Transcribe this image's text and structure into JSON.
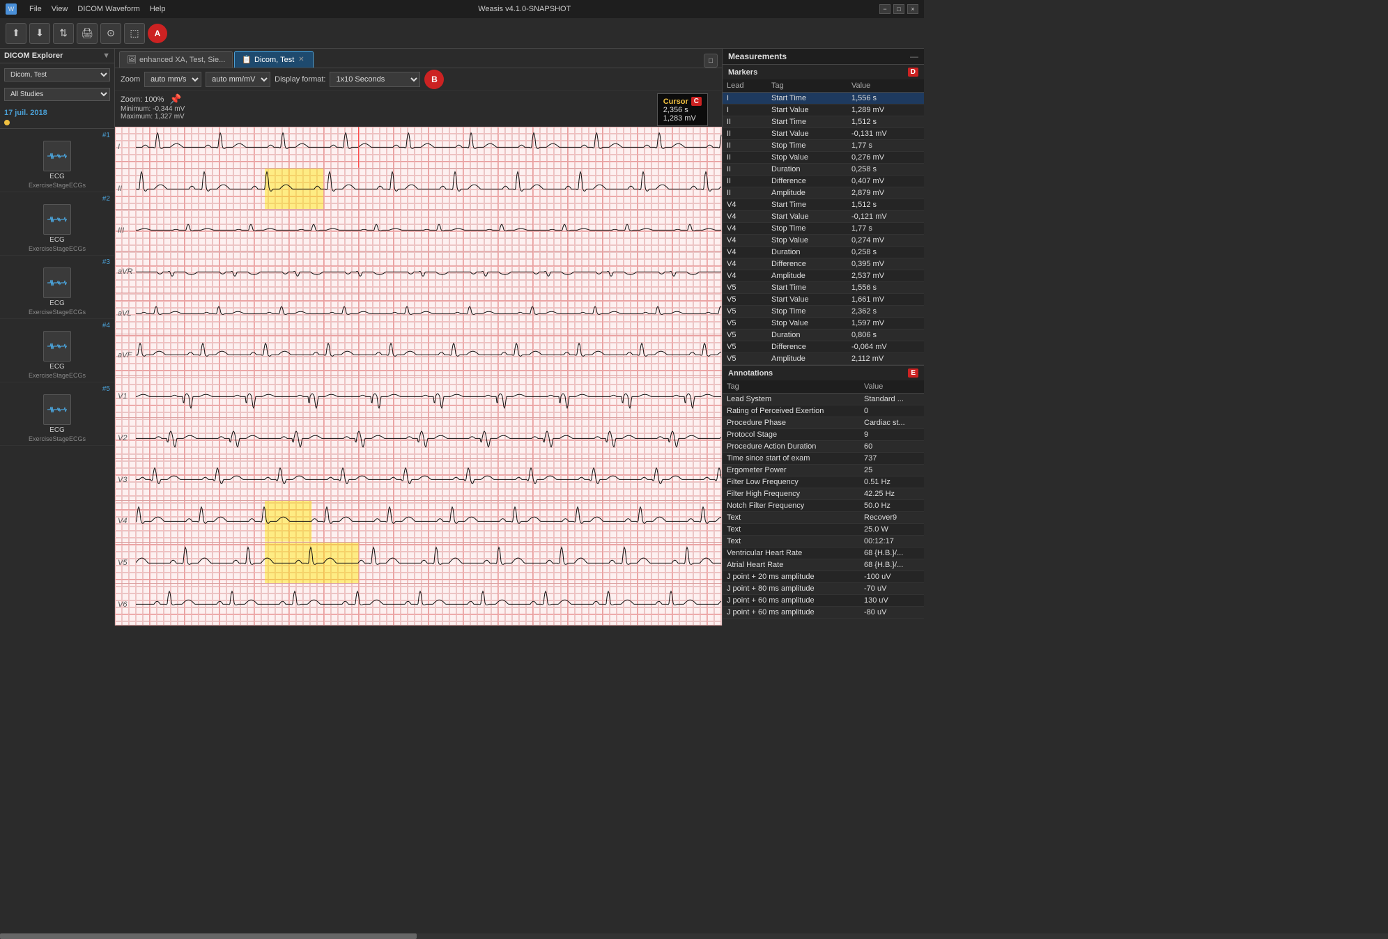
{
  "app": {
    "title": "Weasis v4.1.0-SNAPSHOT",
    "icon": "W"
  },
  "titleBar": {
    "menus": [
      "File",
      "View",
      "DICOM Waveform",
      "Help"
    ],
    "controls": [
      "−",
      "□",
      "×"
    ]
  },
  "toolbar": {
    "buttons": [
      "import-icon",
      "export-icon",
      "open-icon",
      "print-icon",
      "circ-icon",
      "rect-icon"
    ],
    "labelA": "A"
  },
  "tabs": [
    {
      "id": "tab1",
      "label": "enhanced XA, Test, Sie...",
      "active": false,
      "closable": false,
      "icon": "🖼"
    },
    {
      "id": "tab2",
      "label": "Dicom, Test",
      "active": true,
      "closable": true,
      "icon": "📋"
    }
  ],
  "controls": {
    "zoomLabel": "Zoom",
    "zoomOptions": [
      "auto mm/s"
    ],
    "zoomOptions2": [
      "auto mm/mV"
    ],
    "displayFormatLabel": "Display format:",
    "displayFormatOptions": [
      "1x10 Seconds"
    ],
    "labelB": "B"
  },
  "zoomInfo": {
    "zoom": "Zoom: 100%",
    "cursor_label": "Cursor",
    "labelC": "C",
    "minimum": "Minimum: -0,344 mV",
    "maximum": "Maximum: 1,327 mV",
    "cursorTime": "2,356 s",
    "cursorValue": "1,283 mV"
  },
  "sidebar": {
    "title": "DICOM Explorer",
    "patientSelect": "Dicom, Test",
    "studySelect": "All Studies",
    "dateLabel": "17 juil. 2018",
    "studies": [
      {
        "num": "#1",
        "type": "ECG",
        "label": "ECG",
        "sublabel": "ExerciseStageECGs",
        "hasDot": true
      },
      {
        "num": "#2",
        "type": "ECG",
        "label": "ECG",
        "sublabel": "ExerciseStageECGs",
        "hasDot": false
      },
      {
        "num": "#3",
        "type": "ECG",
        "label": "ECG",
        "sublabel": "ExerciseStageECGs",
        "hasDot": false
      },
      {
        "num": "#4",
        "type": "ECG",
        "label": "ECG",
        "sublabel": "ExerciseStageECGs",
        "hasDot": false
      },
      {
        "num": "#5",
        "type": "ECG",
        "label": "ECG",
        "sublabel": "ExerciseStageECGs",
        "hasDot": false
      }
    ]
  },
  "leads": [
    {
      "id": "I",
      "label": "I"
    },
    {
      "id": "II",
      "label": "II"
    },
    {
      "id": "III",
      "label": "III"
    },
    {
      "id": "aVR",
      "label": "aVR"
    },
    {
      "id": "aVL",
      "label": "aVL"
    },
    {
      "id": "aVF",
      "label": "aVF"
    },
    {
      "id": "V1",
      "label": "V1"
    },
    {
      "id": "V2",
      "label": "V2"
    },
    {
      "id": "V3",
      "label": "V3"
    },
    {
      "id": "V4",
      "label": "V4"
    },
    {
      "id": "V5",
      "label": "V5"
    },
    {
      "id": "V6",
      "label": "V6"
    }
  ],
  "measurements": {
    "title": "Measurements",
    "markersLabel": "Markers",
    "labelD": "D",
    "markersColumns": [
      "Lead",
      "Tag",
      "Value"
    ],
    "markers": [
      {
        "lead": "I",
        "tag": "Start Time",
        "value": "1,556 s"
      },
      {
        "lead": "I",
        "tag": "Start Value",
        "value": "1,289 mV"
      },
      {
        "lead": "II",
        "tag": "Start Time",
        "value": "1,512 s"
      },
      {
        "lead": "II",
        "tag": "Start Value",
        "value": "-0,131 mV"
      },
      {
        "lead": "II",
        "tag": "Stop Time",
        "value": "1,77 s"
      },
      {
        "lead": "II",
        "tag": "Stop Value",
        "value": "0,276 mV"
      },
      {
        "lead": "II",
        "tag": "Duration",
        "value": "0,258 s"
      },
      {
        "lead": "II",
        "tag": "Difference",
        "value": "0,407 mV"
      },
      {
        "lead": "II",
        "tag": "Amplitude",
        "value": "2,879 mV"
      },
      {
        "lead": "V4",
        "tag": "Start Time",
        "value": "1,512 s"
      },
      {
        "lead": "V4",
        "tag": "Start Value",
        "value": "-0,121 mV"
      },
      {
        "lead": "V4",
        "tag": "Stop Time",
        "value": "1,77 s"
      },
      {
        "lead": "V4",
        "tag": "Stop Value",
        "value": "0,274 mV"
      },
      {
        "lead": "V4",
        "tag": "Duration",
        "value": "0,258 s"
      },
      {
        "lead": "V4",
        "tag": "Difference",
        "value": "0,395 mV"
      },
      {
        "lead": "V4",
        "tag": "Amplitude",
        "value": "2,537 mV"
      },
      {
        "lead": "V5",
        "tag": "Start Time",
        "value": "1,556 s"
      },
      {
        "lead": "V5",
        "tag": "Start Value",
        "value": "1,661 mV"
      },
      {
        "lead": "V5",
        "tag": "Stop Time",
        "value": "2,362 s"
      },
      {
        "lead": "V5",
        "tag": "Stop Value",
        "value": "1,597 mV"
      },
      {
        "lead": "V5",
        "tag": "Duration",
        "value": "0,806 s"
      },
      {
        "lead": "V5",
        "tag": "Difference",
        "value": "-0,064 mV"
      },
      {
        "lead": "V5",
        "tag": "Amplitude",
        "value": "2,112 mV"
      }
    ],
    "annotationsLabel": "Annotations",
    "labelE": "E",
    "annotationsColumns": [
      "Tag",
      "Value"
    ],
    "annotations": [
      {
        "tag": "Lead System",
        "value": "Standard ..."
      },
      {
        "tag": "Rating of Perceived Exertion",
        "value": "0"
      },
      {
        "tag": "Procedure Phase",
        "value": "Cardiac st..."
      },
      {
        "tag": "Protocol Stage",
        "value": "9"
      },
      {
        "tag": "Procedure Action Duration",
        "value": "60"
      },
      {
        "tag": "Time since start of exam",
        "value": "737"
      },
      {
        "tag": "Ergometer Power",
        "value": "25"
      },
      {
        "tag": "Filter Low Frequency",
        "value": "0.51 Hz"
      },
      {
        "tag": "Filter High Frequency",
        "value": "42.25 Hz"
      },
      {
        "tag": "Notch Filter Frequency",
        "value": "50.0 Hz"
      },
      {
        "tag": "Text",
        "value": "Recover9"
      },
      {
        "tag": "Text",
        "value": "25.0 W"
      },
      {
        "tag": "Text",
        "value": "00:12:17"
      },
      {
        "tag": "Ventricular Heart Rate",
        "value": "68 {H.B.}/..."
      },
      {
        "tag": "Atrial Heart Rate",
        "value": "68 {H.B.}/..."
      },
      {
        "tag": "J point + 20 ms amplitude",
        "value": "-100 uV"
      },
      {
        "tag": "J point + 80 ms amplitude",
        "value": "-70 uV"
      },
      {
        "tag": "J point + 60 ms amplitude",
        "value": "130 uV"
      },
      {
        "tag": "J point + 60 ms amplitude",
        "value": "-80 uV"
      }
    ]
  }
}
